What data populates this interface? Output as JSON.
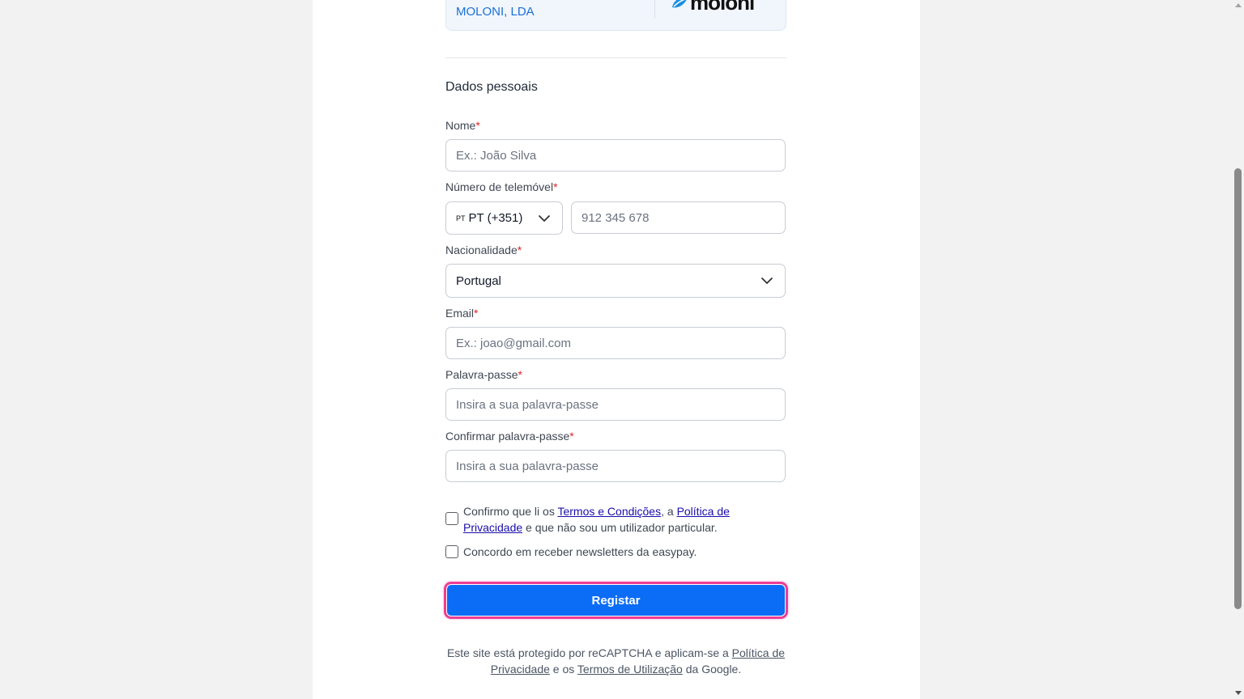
{
  "company": {
    "name": "MOLONI, LDA",
    "logo_text": "moloni"
  },
  "section_title": "Dados pessoais",
  "fields": {
    "name": {
      "label": "Nome",
      "required_mark": "*",
      "placeholder": "Ex.: João Silva",
      "value": ""
    },
    "phone": {
      "label": "Número de telemóvel",
      "required_mark": "*",
      "country_flag": "PT",
      "country_value": "PT (+351)",
      "placeholder": "912 345 678",
      "value": ""
    },
    "nationality": {
      "label": "Nacionalidade",
      "required_mark": "*",
      "value": "Portugal"
    },
    "email": {
      "label": "Email",
      "required_mark": "*",
      "placeholder": "Ex.: joao@gmail.com",
      "value": ""
    },
    "password": {
      "label": "Palavra-passe",
      "required_mark": "*",
      "placeholder": "Insira a sua palavra-passe",
      "value": ""
    },
    "confirm_password": {
      "label": "Confirmar palavra-passe",
      "required_mark": "*",
      "placeholder": "Insira a sua palavra-passe",
      "value": ""
    }
  },
  "consents": {
    "terms": {
      "checked": false,
      "text_1": "Confirmo que li os ",
      "link_terms": "Termos e Condições",
      "text_2": ", a ",
      "link_privacy": "Política de Privacidade",
      "text_3": " e que não sou um utilizador particular."
    },
    "newsletter": {
      "checked": false,
      "text": "Concordo em receber newsletters da easypay."
    }
  },
  "submit_label": "Registar",
  "recaptcha": {
    "text_1": "Este site está protegido por reCAPTCHA e aplicam-se a ",
    "link_privacy": "Política de Privacidade",
    "text_2": " e os ",
    "link_terms": "Termos de Utilização",
    "text_3": " da Google."
  },
  "colors": {
    "primary": "#0b6cf5",
    "focus_ring": "#ec3d96",
    "required": "#e02424",
    "company_accent": "#1a6fd6"
  }
}
